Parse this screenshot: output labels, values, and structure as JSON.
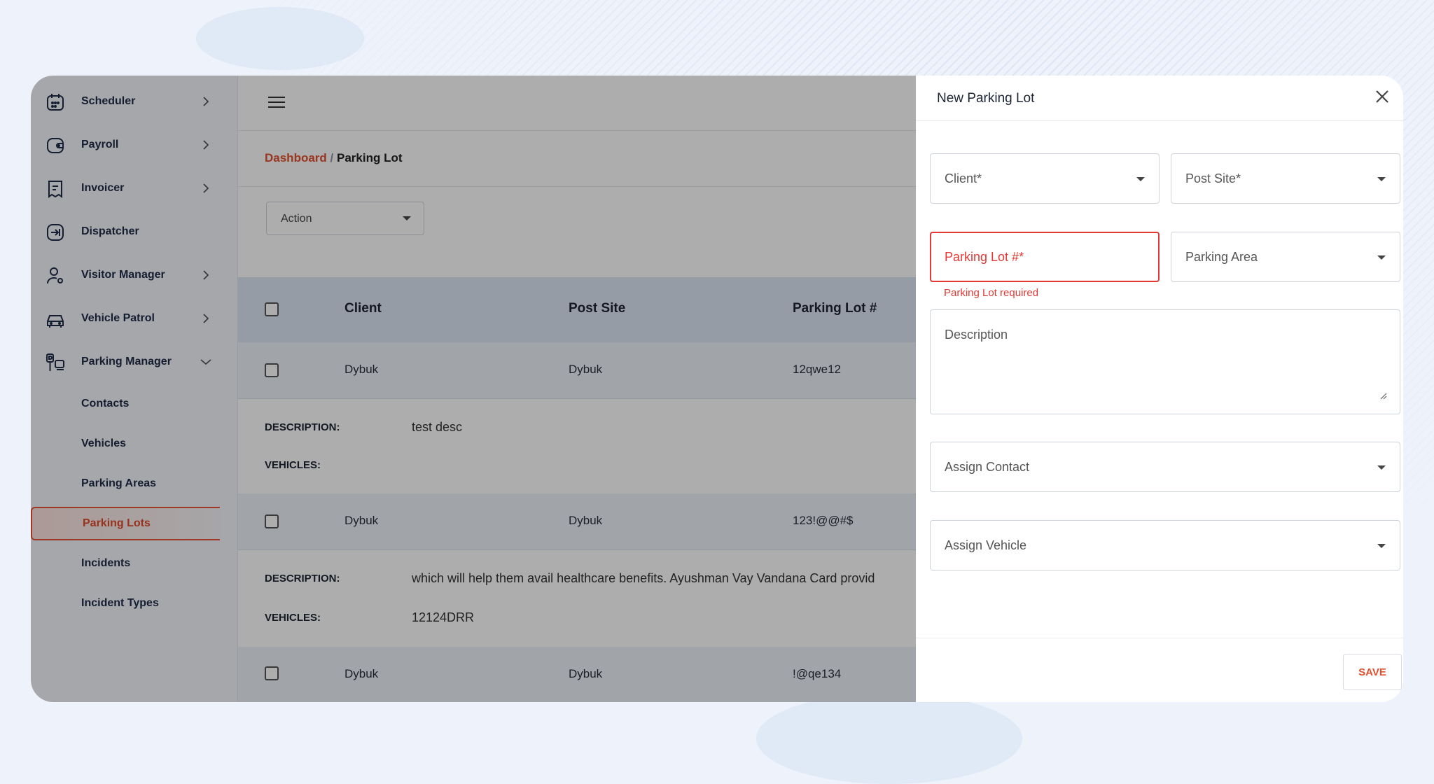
{
  "sidebar": {
    "items": [
      {
        "label": "Scheduler",
        "icon": "calendar-icon",
        "expandable": true
      },
      {
        "label": "Payroll",
        "icon": "wallet-icon",
        "expandable": true
      },
      {
        "label": "Invoicer",
        "icon": "invoice-icon",
        "expandable": true
      },
      {
        "label": "Dispatcher",
        "icon": "dispatch-icon",
        "expandable": false
      },
      {
        "label": "Visitor Manager",
        "icon": "visitor-icon",
        "expandable": true
      },
      {
        "label": "Vehicle Patrol",
        "icon": "car-icon",
        "expandable": true
      },
      {
        "label": "Parking Manager",
        "icon": "parking-icon",
        "expandable": true,
        "expanded": true
      }
    ],
    "subitems": [
      {
        "label": "Contacts"
      },
      {
        "label": "Vehicles"
      },
      {
        "label": "Parking Areas"
      },
      {
        "label": "Parking Lots",
        "active": true
      },
      {
        "label": "Incidents"
      },
      {
        "label": "Incident Types"
      }
    ]
  },
  "breadcrumb": {
    "root": "Dashboard",
    "separator": "/",
    "current": "Parking Lot"
  },
  "action_select": {
    "label": "Action"
  },
  "table": {
    "headers": [
      "Client",
      "Post Site",
      "Parking Lot #"
    ],
    "rows": [
      {
        "client": "Dybuk",
        "post_site": "Dybuk",
        "lot": "12qwe12",
        "description": "test desc",
        "vehicles": ""
      },
      {
        "client": "Dybuk",
        "post_site": "Dybuk",
        "lot": "123!@@#$",
        "description": "which will help them avail healthcare benefits. Ayushman Vay Vandana Card provid",
        "vehicles": "12124DRR"
      },
      {
        "client": "Dybuk",
        "post_site": "Dybuk",
        "lot": "!@qe134"
      }
    ],
    "description_label": "DESCRIPTION:",
    "vehicles_label": "VEHICLES:"
  },
  "drawer": {
    "title": "New Parking Lot",
    "fields": {
      "client": "Client*",
      "post_site": "Post Site*",
      "parking_lot": "Parking Lot #*",
      "parking_area": "Parking Area",
      "description": "Description",
      "assign_contact": "Assign Contact",
      "assign_vehicle": "Assign Vehicle"
    },
    "error": "Parking Lot required",
    "save_label": "SAVE"
  },
  "colors": {
    "accent": "#e2502f",
    "error": "#e53935",
    "table_header": "#dde6f4",
    "sidebar_text": "#1f2b49"
  }
}
